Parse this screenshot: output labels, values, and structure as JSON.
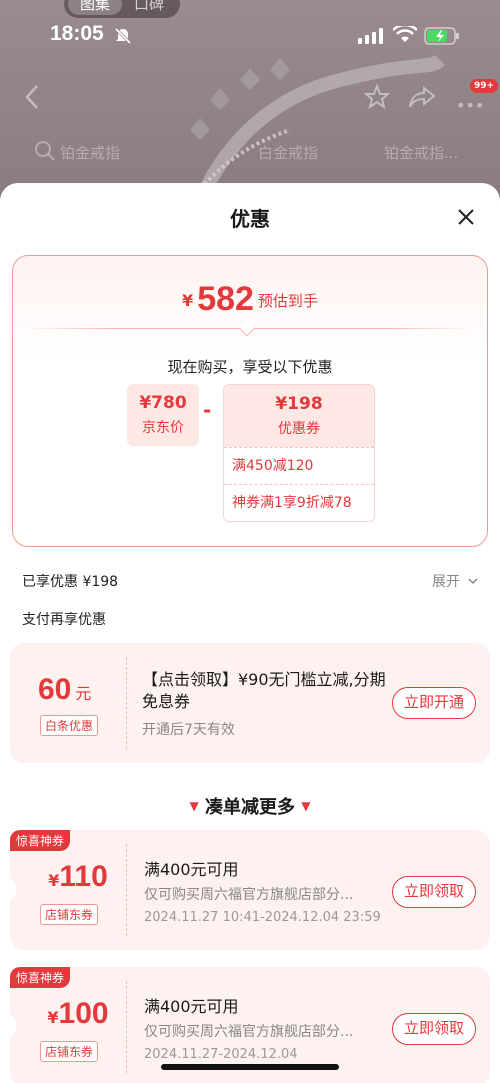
{
  "backdrop": {
    "segment": [
      "图集",
      "口碑"
    ],
    "status": {
      "time": "18:05"
    },
    "badge": "99+",
    "search_items": [
      "铂金戒指",
      "白金戒指",
      "铂金戒指..."
    ]
  },
  "sheet": {
    "title": "优惠",
    "summary": {
      "currency": "¥",
      "final_price": "582",
      "final_label": "预估到手",
      "buy_text": "现在购买，享受以下优惠",
      "jd_price": "¥780",
      "jd_label": "京东价",
      "minus": "-",
      "coupon_value": "¥198",
      "coupon_label": "优惠券",
      "coupon_rows": [
        "满450减120",
        "神券满1享9折减78"
      ]
    },
    "enjoyed": "已享优惠 ¥198",
    "expand": "展开",
    "pay_title": "支付再享优惠",
    "baitiao": {
      "amount": "60",
      "unit": "元",
      "tag": "白条优惠",
      "title": "【点击领取】¥90无门槛立减,分期免息券",
      "sub": "开通后7天有效",
      "button": "立即开通"
    },
    "more_title": "凑单减更多",
    "coupons": [
      {
        "ribbon": "惊喜神券",
        "currency": "¥",
        "amount": "110",
        "tag": "店铺东券",
        "title": "满400元可用",
        "desc": "仅可购买周六福官方旗舰店部分...",
        "date": "2024.11.27 10:41-2024.12.04 23:59",
        "button": "立即领取"
      },
      {
        "ribbon": "惊喜神券",
        "currency": "¥",
        "amount": "100",
        "tag": "店铺东券",
        "title": "满400元可用",
        "desc": "仅可购买周六福官方旗舰店部分...",
        "date": "2024.11.27-2024.12.04",
        "button": "立即领取"
      }
    ]
  },
  "colors": {
    "accent": "#e4393c",
    "card_bg": "#fdf2f0",
    "border": "#f19a90"
  }
}
